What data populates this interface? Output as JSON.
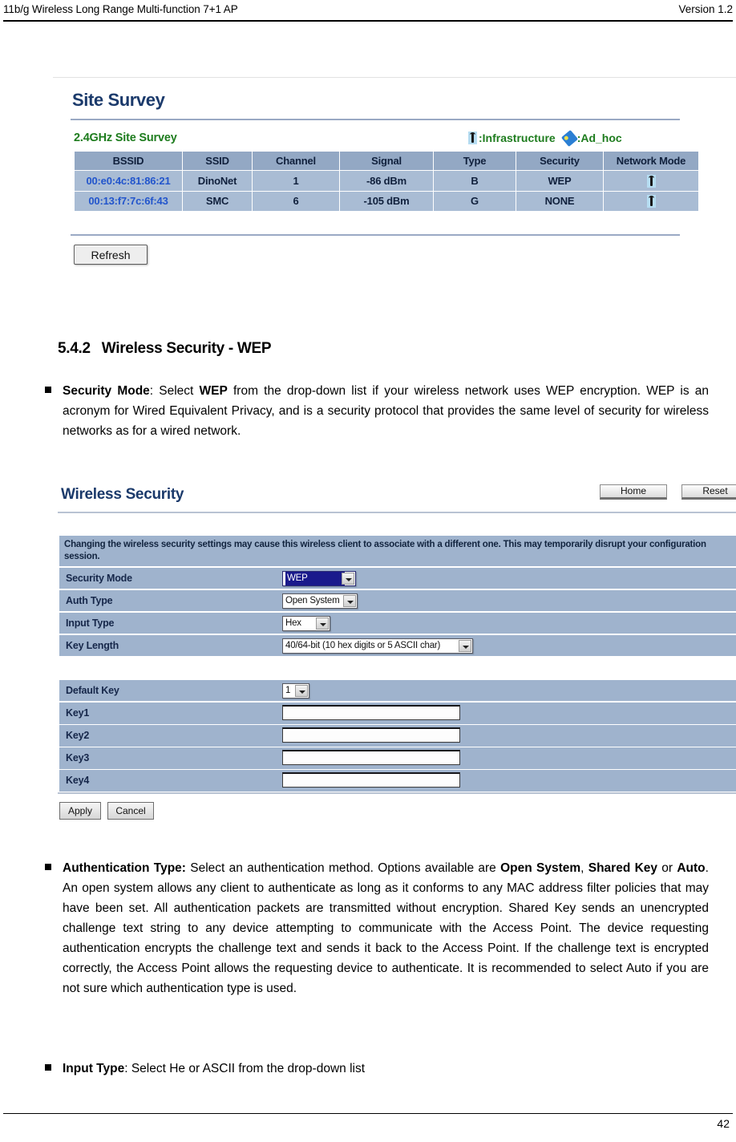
{
  "header": {
    "left_title": "11b/g Wireless Long Range Multi-function 7+1 AP",
    "right_version": "Version 1.2"
  },
  "site_survey_panel": {
    "title": "Site Survey",
    "subtitle": "2.4GHz Site Survey",
    "legend": {
      "infrastructure_label": ":Infrastructure",
      "adhoc_label": ":Ad_hoc",
      "infrastructure_icon": "infrastructure-icon",
      "adhoc_icon": "adhoc-icon"
    },
    "table": {
      "columns": [
        "BSSID",
        "SSID",
        "Channel",
        "Signal",
        "Type",
        "Security",
        "Network Mode"
      ],
      "rows": [
        {
          "bssid": "00:e0:4c:81:86:21",
          "ssid": "DinoNet",
          "channel": "1",
          "signal": "-86 dBm",
          "type": "B",
          "security": "WEP",
          "network_mode": "infrastructure-icon"
        },
        {
          "bssid": "00:13:f7:7c:6f:43",
          "ssid": "SMC",
          "channel": "6",
          "signal": "-105 dBm",
          "type": "G",
          "security": "NONE",
          "network_mode": "infrastructure-icon"
        }
      ]
    },
    "refresh_label": "Refresh"
  },
  "section": {
    "number": "5.4.2",
    "title": "Wireless Security - WEP"
  },
  "bullets": {
    "security_mode": {
      "lead": "Security Mode",
      "text_1": ": Select ",
      "emphasis": "WEP",
      "text_2": " from the drop-down list if your wireless network uses WEP encryption. WEP is an acronym for Wired Equivalent Privacy, and is a security protocol that provides the same level of security for wireless networks as for a wired network."
    },
    "auth_type": {
      "lead": "Authentication Type:",
      "text_1": " Select an authentication method. Options available are ",
      "em_1": "Open System",
      "text_2": ", ",
      "em_2": "Shared Key",
      "text_3": " or ",
      "em_3": "Auto",
      "text_4": ". An open system allows any client to authenticate as long as it conforms to any MAC address filter policies that may have been set. All authentication packets are transmitted without encryption. Shared Key sends an unencrypted challenge text string to any device attempting to communicate with the Access Point. The device requesting authentication encrypts the challenge text and sends it back to the Access Point. If the challenge text is encrypted correctly, the Access Point allows the requesting device to authenticate. It is recommended to select Auto if you are not sure which authentication type is used."
    },
    "input_type": {
      "lead": "Input Type",
      "text": ": Select He or ASCII from the drop-down list"
    }
  },
  "wireless_security_panel": {
    "title": "Wireless Security",
    "home_label": "Home",
    "reset_label": "Reset",
    "note": "Changing the wireless security settings may cause this wireless client to associate with a different one. This may temporarily disrupt your configuration session.",
    "fields": [
      {
        "label": "Security Mode",
        "value": "WEP"
      },
      {
        "label": "Auth Type",
        "value": "Open System"
      },
      {
        "label": "Input Type",
        "value": "Hex"
      },
      {
        "label": "Key Length",
        "value": "40/64-bit (10 hex digits or 5 ASCII char)"
      },
      {
        "label": "Default Key",
        "value": "1"
      },
      {
        "label": "Key1",
        "value": ""
      },
      {
        "label": "Key2",
        "value": ""
      },
      {
        "label": "Key3",
        "value": ""
      },
      {
        "label": "Key4",
        "value": ""
      }
    ],
    "apply_label": "Apply",
    "cancel_label": "Cancel"
  },
  "footer": {
    "page_number": "42"
  },
  "colors": {
    "panel_title": "#1b3a6b",
    "subtitle_green": "#1e7c1e",
    "bssid_blue": "#2255cc",
    "table_header_bg": "#93a8c4",
    "table_row_bg": "#a9bcd4",
    "form_row_bg": "#9fb3cd",
    "selected_option_bg": "#1a1a8c"
  }
}
